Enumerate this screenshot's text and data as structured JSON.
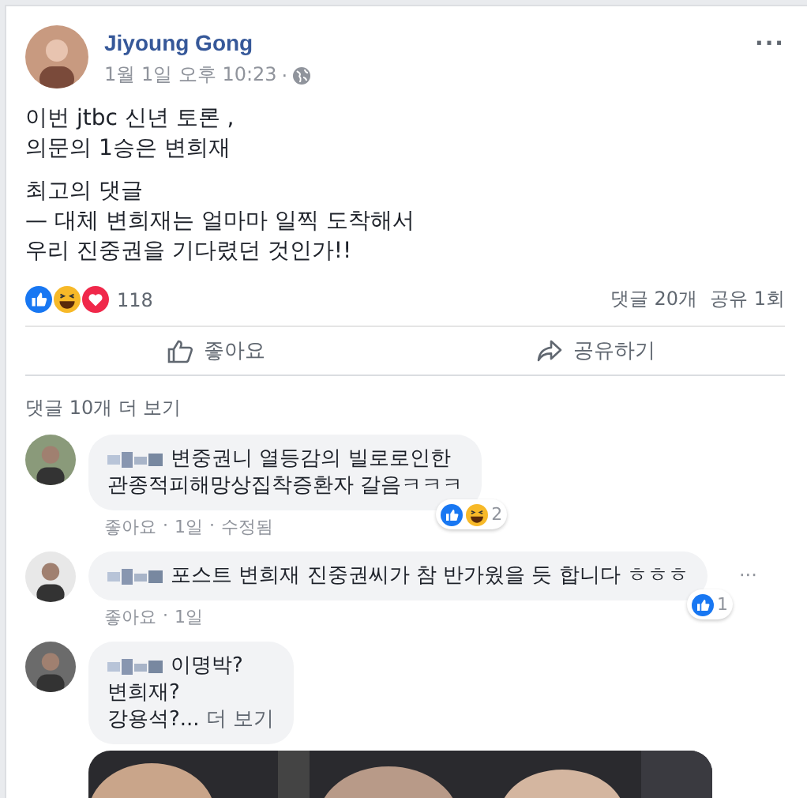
{
  "post": {
    "author": "Jiyoung Gong",
    "time": "1월 1일 오후 10:23",
    "separator": "·",
    "lines": [
      "이번 jtbc 신년 토론 ,",
      "의문의 1승은 변희재"
    ],
    "lines_2": [
      "최고의 댓글",
      "— 대체 변희재는 얼마마 일찍 도착해서",
      "우리 진중권을 기다렸던 것인가!!"
    ]
  },
  "reactions": {
    "count": "118",
    "types": [
      {
        "kind": "like"
      },
      {
        "kind": "haha"
      },
      {
        "kind": "love"
      }
    ],
    "comments": "댓글 20개",
    "shares": "공유 1회"
  },
  "actions": [
    {
      "kind": "like",
      "label": "좋아요"
    },
    {
      "kind": "share",
      "label": "공유하기"
    }
  ],
  "more_comments": "댓글 10개 더 보기",
  "meta_separator": "·",
  "comments": [
    {
      "lines": [
        "변중권니 열등감의 빌로로인한",
        "관종적피해망상집착증환자 갈음ㅋㅋㅋ"
      ],
      "reactions": [
        {
          "kind": "like"
        },
        {
          "kind": "haha"
        }
      ],
      "reaction_count": "2",
      "meta": [
        "좋아요",
        "1일",
        "수정됨"
      ]
    },
    {
      "lines": [
        "포스트 변희재 진중권씨가 참 반가웠을 듯 합니다 ㅎㅎㅎ"
      ],
      "reactions": [
        {
          "kind": "like"
        }
      ],
      "reaction_count": "1",
      "meta": [
        "좋아요",
        "1일"
      ],
      "menu": "···"
    },
    {
      "lines": [
        "이명박?",
        "변희재?",
        "강용석?..."
      ],
      "more": "더 보기"
    }
  ],
  "menu_icon": "···"
}
